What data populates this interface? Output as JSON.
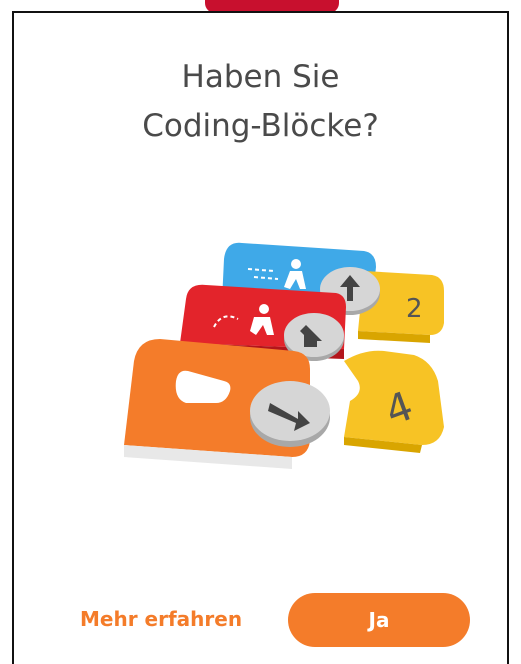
{
  "dialog": {
    "title_line1": "Haben Sie",
    "title_line2": "Coding-Blöcke?"
  },
  "illustration": {
    "icon": "coding-blocks-image",
    "block_numbers": [
      "2",
      "4"
    ]
  },
  "footer": {
    "more_label": "Mehr erfahren",
    "yes_label": "Ja"
  },
  "colors": {
    "accent": "#f47c2a",
    "top_tab": "#c8102e",
    "title_text": "#4a4a4a",
    "block_blue": "#3fa9e8",
    "block_red": "#e3242b",
    "block_orange": "#f47c2a",
    "block_yellow": "#f7c325"
  }
}
